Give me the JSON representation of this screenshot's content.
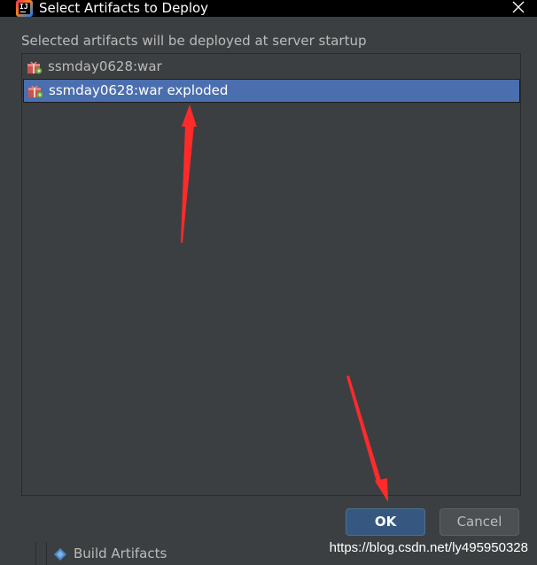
{
  "window": {
    "title": "Select Artifacts to Deploy",
    "app_icon_text": "IJ"
  },
  "dialog": {
    "subtitle": "Selected artifacts will be deployed at server startup",
    "artifacts": [
      {
        "label": "ssmday0628:war",
        "selected": false,
        "icon": "war-artifact-icon"
      },
      {
        "label": "ssmday0628:war exploded",
        "selected": true,
        "icon": "war-artifact-icon"
      }
    ]
  },
  "buttons": {
    "ok_label": "OK",
    "cancel_label": "Cancel"
  },
  "background_panel": {
    "item_label": "Build Artifacts",
    "item_icon": "build-artifacts-icon"
  },
  "watermark": "https://blog.csdn.net/ly495950328",
  "colors": {
    "dialog_bg": "#3c3f41",
    "selection": "#4b6eaf",
    "ok_button": "#365880",
    "cancel_button": "#4c5052",
    "text": "#bbbbbb",
    "annotation": "#ff2a2a"
  }
}
